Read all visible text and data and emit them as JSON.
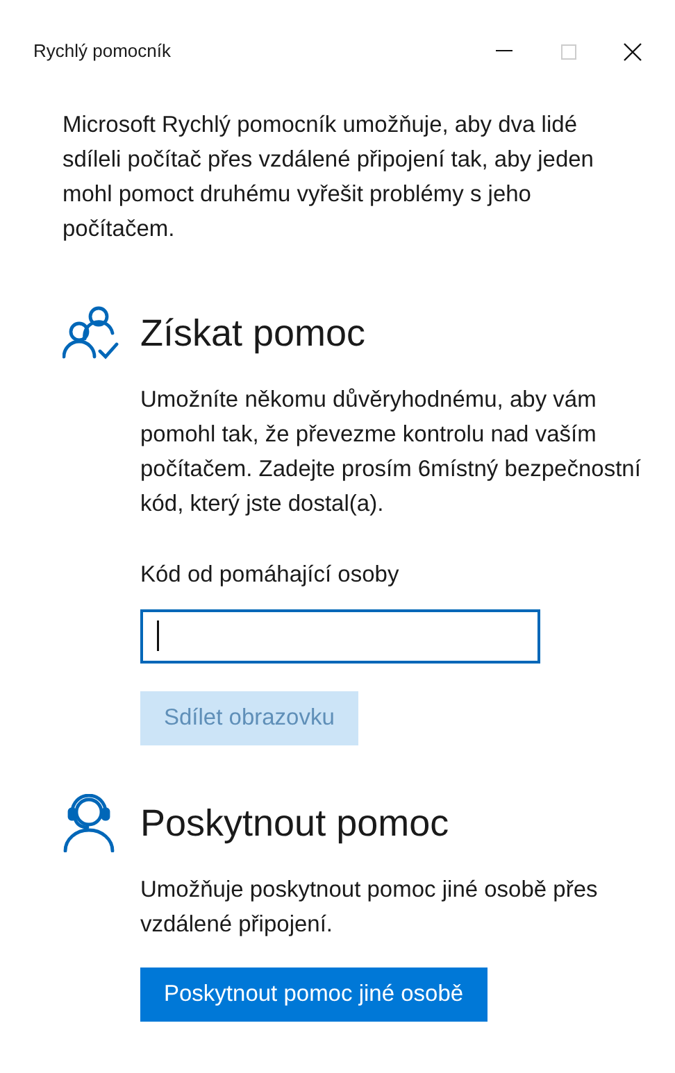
{
  "window": {
    "title": "Rychlý pomocník"
  },
  "intro": "Microsoft Rychlý pomocník umožňuje, aby dva lidé sdíleli počítač přes vzdálené připojení tak, aby jeden mohl pomoct druhému vyřešit problémy s jeho počítačem.",
  "sections": [
    {
      "kind": "get",
      "heading": "Získat pomoc",
      "description": "Umožníte někomu důvěryhodnému, aby vám pomohl tak, že převezme kontrolu nad vaším počítačem. Zadejte prosím 6místný bezpečnostní kód, který jste dostal(a).",
      "field": {
        "label": "Kód od pomáhající osoby",
        "focused": true
      },
      "button": {
        "label": "Sdílet obrazovku",
        "disabled": true
      }
    },
    {
      "kind": "give",
      "heading": "Poskytnout pomoc",
      "description": "Umožňuje poskytnout pomoc jiné osobě přes vzdálené připojení.",
      "button": {
        "label": "Poskytnout pomoc jiné osobě",
        "disabled": false
      }
    }
  ]
}
